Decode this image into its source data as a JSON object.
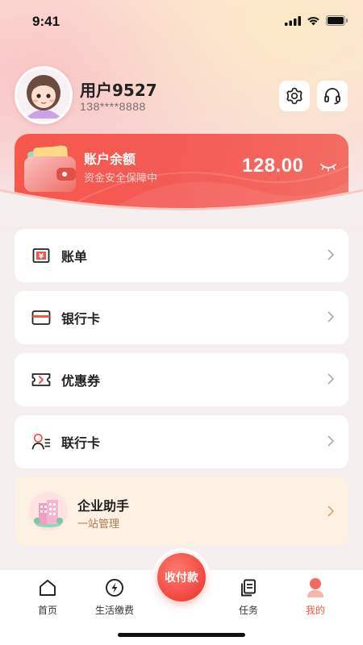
{
  "status_bar": {
    "time": "9:41"
  },
  "profile": {
    "username": "用户9527",
    "phone": "138****8888"
  },
  "balance": {
    "label": "账户余额",
    "subtitle": "资金安全保障中",
    "amount": "128.00"
  },
  "menu": [
    {
      "label": "账单",
      "icon": "bill-icon"
    },
    {
      "label": "银行卡",
      "icon": "bank-card-icon"
    },
    {
      "label": "优惠券",
      "icon": "coupon-icon"
    },
    {
      "label": "联行卡",
      "icon": "contacts-icon"
    }
  ],
  "enterprise": {
    "title": "企业助手",
    "subtitle": "一站管理"
  },
  "tabbar": {
    "home": "首页",
    "payments": "生活缴费",
    "center": "收付款",
    "tasks": "任务",
    "mine": "我的"
  },
  "colors": {
    "accent": "#f2574c",
    "card": "#f5574c",
    "enterprise_bg": "#fdf1e4"
  }
}
